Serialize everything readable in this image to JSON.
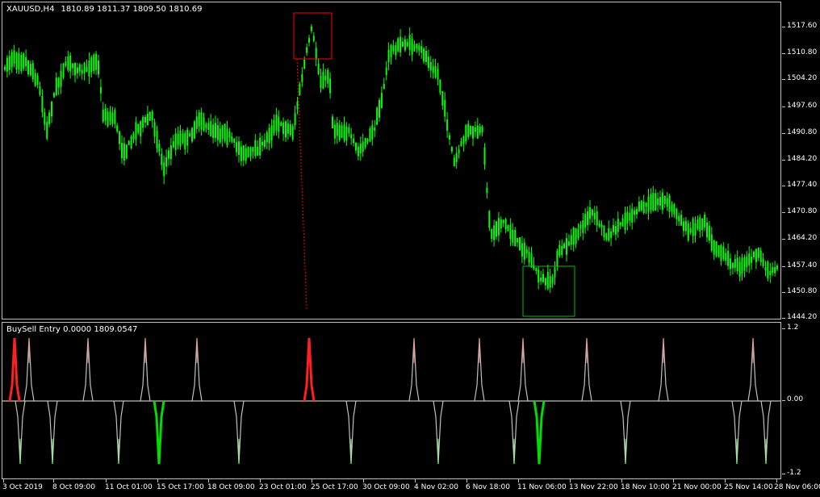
{
  "main_chart": {
    "symbol": "XAUUSD,H4",
    "open": "1810.89",
    "high": "1811.37",
    "low": "1809.50",
    "close": "1810.69",
    "y_labels": [
      "1517.60",
      "1510.80",
      "1504.20",
      "1497.60",
      "1490.80",
      "1484.20",
      "1477.40",
      "1470.80",
      "1464.20",
      "1457.40",
      "1450.80",
      "1444.20"
    ],
    "colors": {
      "candles": "#00ff00",
      "sell_box": "#ff0000",
      "buy_box": "#00c000",
      "trend_line": "#ff0000"
    }
  },
  "indicator": {
    "name": "BuySell Entry",
    "value1": "0.0000",
    "value2": "1809.0547",
    "y_labels": [
      "1.2",
      "0.00",
      "-1.2"
    ],
    "colors": {
      "line": "#c0c0c0",
      "sell_spike": "#ff2020",
      "buy_spike": "#00dd00"
    }
  },
  "x_axis": {
    "labels": [
      "3 Oct 2019",
      "8 Oct 09:00",
      "11 Oct 01:00",
      "15 Oct 17:00",
      "18 Oct 09:00",
      "23 Oct 01:00",
      "25 Oct 17:00",
      "30 Oct 09:00",
      "4 Nov 02:00",
      "6 Nov 18:00",
      "11 Nov 06:00",
      "13 Nov 22:00",
      "18 Nov 10:00",
      "21 Nov 00:00",
      "25 Nov 14:00",
      "28 Nov 06:00"
    ]
  }
}
